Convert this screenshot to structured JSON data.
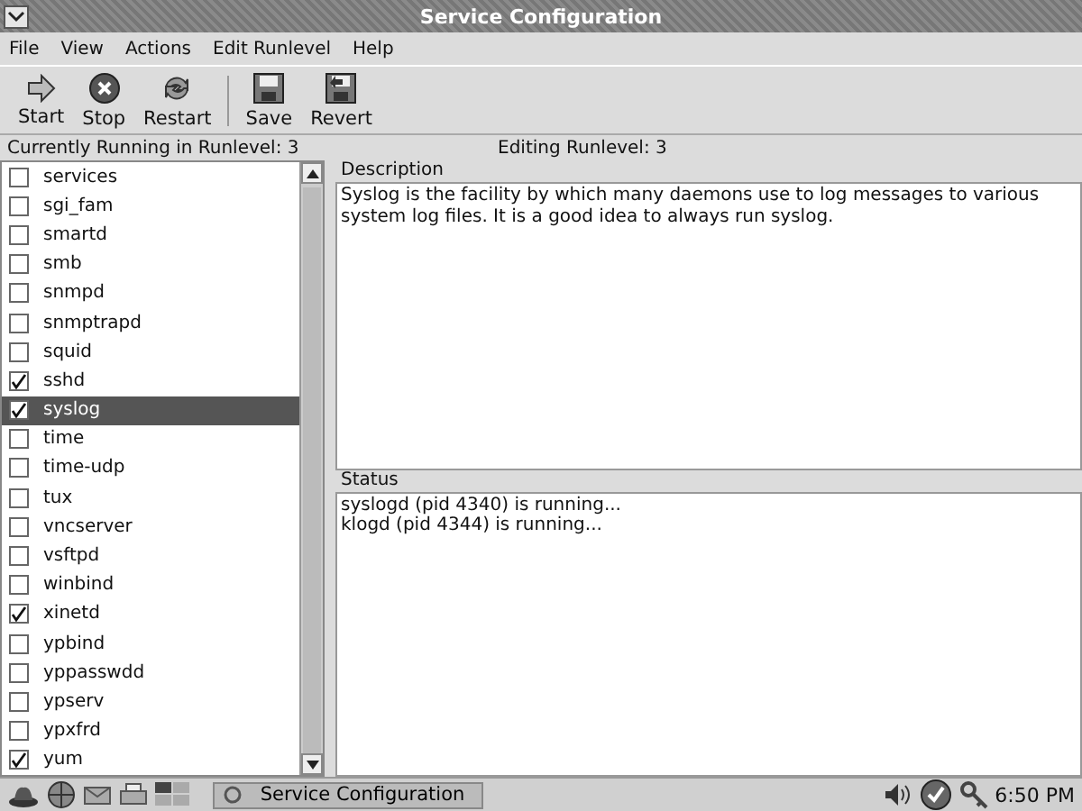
{
  "window": {
    "title": "Service Configuration"
  },
  "menu": [
    "File",
    "View",
    "Actions",
    "Edit Runlevel",
    "Help"
  ],
  "toolbar": [
    {
      "label": "Start",
      "kind": "start"
    },
    {
      "label": "Stop",
      "kind": "stop"
    },
    {
      "label": "Restart",
      "kind": "restart"
    },
    {
      "label": "Save",
      "kind": "save"
    },
    {
      "label": "Revert",
      "kind": "revert"
    }
  ],
  "runlevel_info": {
    "current": "Currently Running in Runlevel: 3",
    "editing": "Editing Runlevel: 3"
  },
  "services": [
    {
      "name": "services",
      "checked": false,
      "selected": false
    },
    {
      "name": "sgi_fam",
      "checked": false,
      "selected": false
    },
    {
      "name": "smartd",
      "checked": false,
      "selected": false
    },
    {
      "name": "smb",
      "checked": false,
      "selected": false
    },
    {
      "name": "snmpd",
      "checked": false,
      "selected": false
    },
    {
      "name": "snmptrapd",
      "checked": false,
      "selected": false
    },
    {
      "name": "squid",
      "checked": false,
      "selected": false
    },
    {
      "name": "sshd",
      "checked": true,
      "selected": false
    },
    {
      "name": "syslog",
      "checked": true,
      "selected": true
    },
    {
      "name": "time",
      "checked": false,
      "selected": false
    },
    {
      "name": "time-udp",
      "checked": false,
      "selected": false
    },
    {
      "name": "tux",
      "checked": false,
      "selected": false
    },
    {
      "name": "vncserver",
      "checked": false,
      "selected": false
    },
    {
      "name": "vsftpd",
      "checked": false,
      "selected": false
    },
    {
      "name": "winbind",
      "checked": false,
      "selected": false
    },
    {
      "name": "xinetd",
      "checked": true,
      "selected": false
    },
    {
      "name": "ypbind",
      "checked": false,
      "selected": false
    },
    {
      "name": "yppasswdd",
      "checked": false,
      "selected": false
    },
    {
      "name": "ypserv",
      "checked": false,
      "selected": false
    },
    {
      "name": "ypxfrd",
      "checked": false,
      "selected": false
    },
    {
      "name": "yum",
      "checked": true,
      "selected": false
    }
  ],
  "description": {
    "heading": "Description",
    "text": "Syslog is the facility by which many daemons use to log messages to various system log files.  It is a good idea to always run syslog."
  },
  "status": {
    "heading": "Status",
    "lines": [
      "syslogd (pid 4340) is running...",
      "klogd (pid 4344) is running..."
    ]
  },
  "taskbar": {
    "task": "Service Configuration",
    "clock": "6:50 PM"
  }
}
